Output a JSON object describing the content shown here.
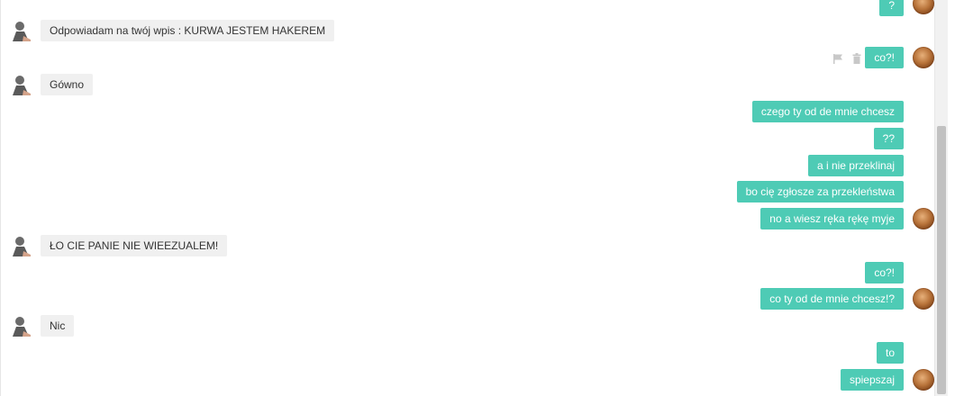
{
  "messages": {
    "m0": "?",
    "m1": "Odpowiadam na twój wpis : KURWA JESTEM HAKEREM",
    "m2": "co?!",
    "m3": "Gówno",
    "m4": "czego ty od de mnie chcesz",
    "m5": "??",
    "m6": "a i nie przeklinaj",
    "m7": "bo cię zgłosze za przekleństwa",
    "m8": "no a wiesz ręka rękę myje",
    "m9": "ŁO CIE PANIE NIE WIEEZUALEM!",
    "m10": "co?!",
    "m11": "co ty od de mnie chcesz!?",
    "m12": "Nic",
    "m13": "to",
    "m14": "spiepszaj"
  },
  "icons": {
    "flag": "flag-icon",
    "trash": "trash-icon",
    "my_avatar": "user-avatar",
    "other_avatar": "contact-avatar"
  },
  "colors": {
    "outgoing_bubble": "#4ecbb5",
    "incoming_bubble": "#f0f0f0",
    "scroll_thumb": "#c1c1c1"
  }
}
